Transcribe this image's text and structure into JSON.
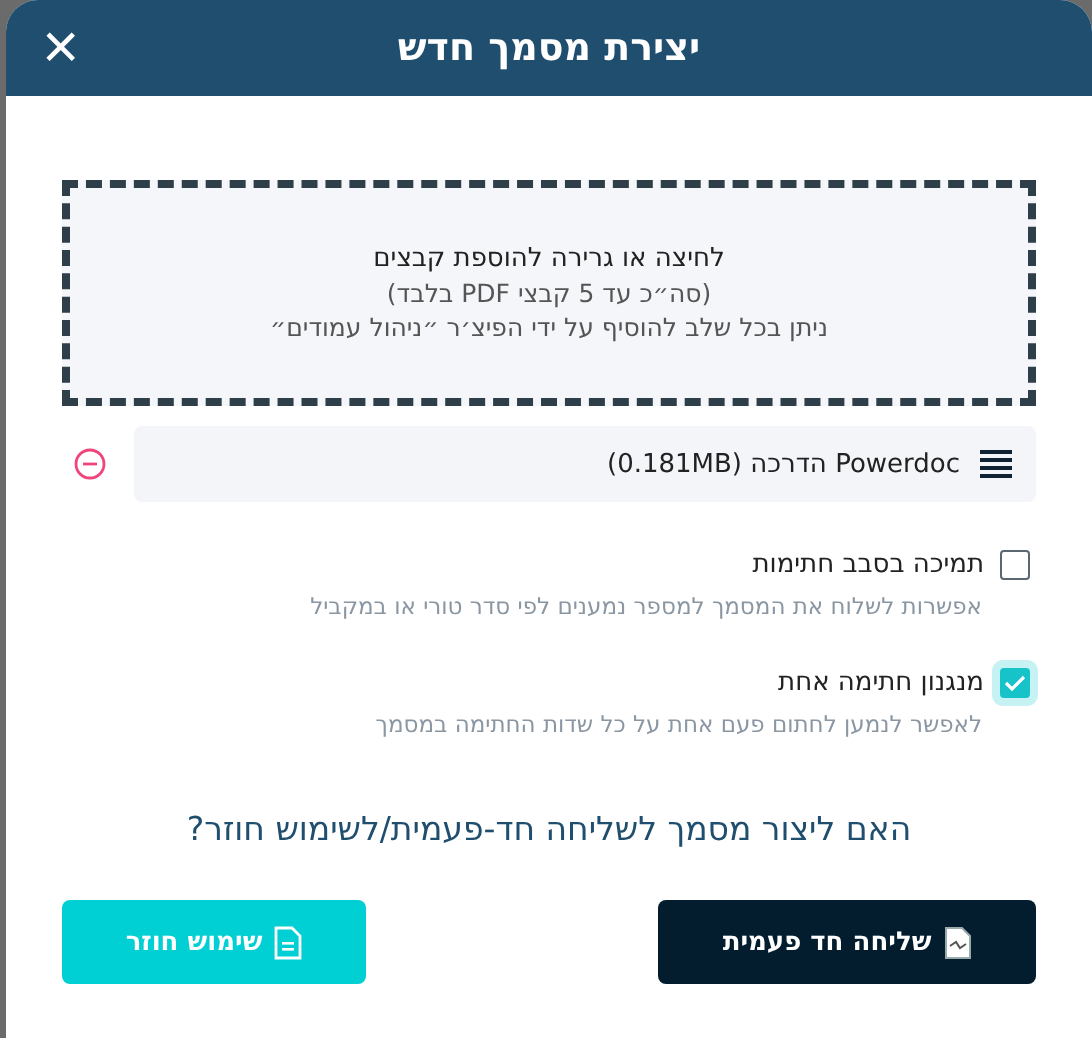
{
  "dialog": {
    "title": "יצירת מסמך חדש",
    "close": "×"
  },
  "dropzone": {
    "title": "לחיצה או גרירה להוספת קבצים",
    "lines": [
      "(סה״כ עד 5 קבצי PDF בלבד)",
      "ניתן בכל שלב להוסיף על ידי הפיצ׳ר ״ניהול עמודים״"
    ]
  },
  "files": [
    {
      "name": "Powerdoc הדרכה (0.181MB)"
    }
  ],
  "options": [
    {
      "label": "תמיכה בסבב חתימות",
      "description": "אפשרות לשלוח את המסמך למספר נמענים לפי סדר טורי או במקביל",
      "checked": false
    },
    {
      "label": "מנגנון חתימה אחת",
      "description": "לאפשר לנמען לחתום פעם אחת על כל שדות החתימה במסמך",
      "checked": true
    }
  ],
  "question": "האם ליצור מסמך לשליחה חד-פעמית/לשימוש חוזר?",
  "buttons": [
    {
      "label": "שליחה חד פעמית",
      "kind": "primary"
    },
    {
      "label": "שימוש חוזר",
      "kind": "secondary"
    }
  ]
}
